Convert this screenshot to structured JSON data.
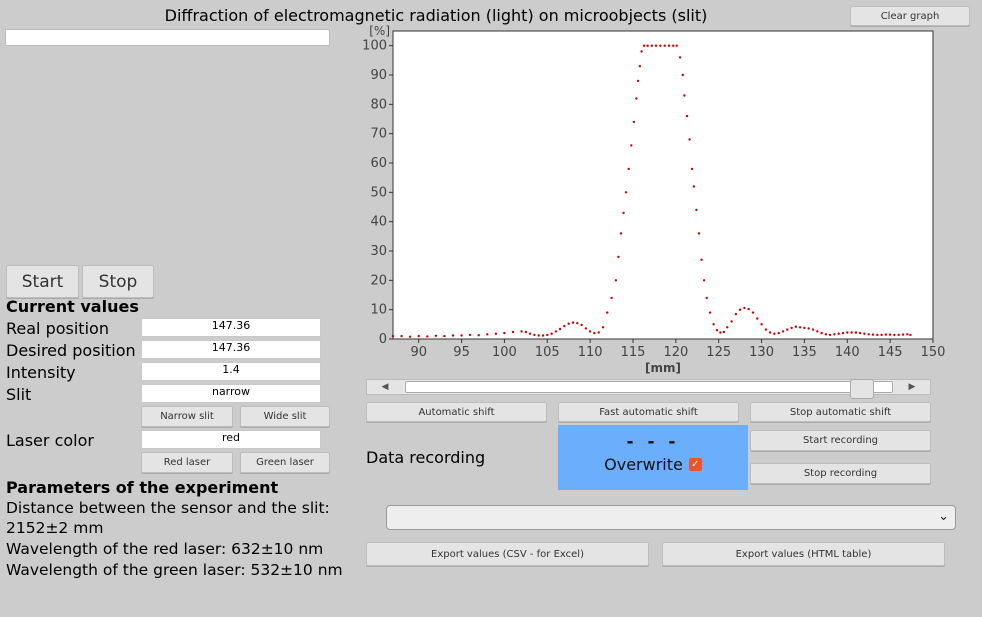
{
  "title": "Diffraction of electromagnetic radiation (light) on microobjects (slit)",
  "buttons": {
    "clear_graph": "Clear graph",
    "start": "Start",
    "stop": "Stop",
    "narrow_slit": "Narrow slit",
    "wide_slit": "Wide slit",
    "red_laser": "Red laser",
    "green_laser": "Green laser",
    "automatic_shift": "Automatic shift",
    "fast_automatic_shift": "Fast automatic shift",
    "stop_automatic_shift": "Stop automatic shift",
    "start_recording": "Start recording",
    "stop_recording": "Stop recording",
    "export_csv": "Export values (CSV - for Excel)",
    "export_html": "Export values (HTML table)"
  },
  "current_values": {
    "heading": "Current values",
    "real_position_label": "Real position",
    "real_position": "147.36",
    "desired_position_label": "Desired position",
    "desired_position": "147.36",
    "intensity_label": "Intensity",
    "intensity": "1.4",
    "slit_label": "Slit",
    "slit": "narrow",
    "laser_color_label": "Laser color",
    "laser_color": "red"
  },
  "parameters": {
    "heading": "Parameters of the experiment",
    "distance": "Distance between the sensor and the slit: 2152±2 mm",
    "red_wavelength": "Wavelength of the red laser: 632±10 nm",
    "green_wavelength": "Wavelength of the green laser: 532±10 nm"
  },
  "recording": {
    "label": "Data recording",
    "status": "- - -",
    "overwrite_label": "Overwrite",
    "overwrite_checked": true
  },
  "scrollbar": {
    "position": 0.96
  },
  "icons": {
    "scroll_left": "triangle-left-icon",
    "scroll_right": "triangle-right-icon",
    "dropdown": "chevron-down-icon",
    "checkbox": "check-icon"
  },
  "colors": {
    "series": "#cc0000",
    "recording_panel": "#6aaefc",
    "checkbox": "#e8572a"
  },
  "chart_data": {
    "type": "scatter",
    "ylabel": "[%]",
    "xlabel": "[mm]",
    "xlim": [
      87,
      150
    ],
    "ylim": [
      0,
      105
    ],
    "xticks": [
      90,
      95,
      100,
      105,
      110,
      115,
      120,
      125,
      130,
      135,
      140,
      145,
      150
    ],
    "yticks": [
      0,
      10,
      20,
      30,
      40,
      50,
      60,
      70,
      80,
      90,
      100
    ],
    "grid": false,
    "series": [
      {
        "color": "#cc0000",
        "points": [
          [
            87,
            1.0
          ],
          [
            88,
            1.0
          ],
          [
            89,
            0.8
          ],
          [
            90,
            1.0
          ],
          [
            91,
            0.9
          ],
          [
            92,
            1.1
          ],
          [
            93,
            1.0
          ],
          [
            94,
            1.2
          ],
          [
            95,
            1.2
          ],
          [
            96,
            1.4
          ],
          [
            97,
            1.3
          ],
          [
            98,
            1.6
          ],
          [
            99,
            1.8
          ],
          [
            100,
            2.0
          ],
          [
            101,
            2.4
          ],
          [
            102,
            2.6
          ],
          [
            102.5,
            2.4
          ],
          [
            103,
            1.8
          ],
          [
            103.5,
            1.4
          ],
          [
            104,
            1.2
          ],
          [
            104.5,
            1.2
          ],
          [
            105,
            1.4
          ],
          [
            105.5,
            1.8
          ],
          [
            106,
            2.6
          ],
          [
            106.5,
            3.4
          ],
          [
            107,
            4.4
          ],
          [
            107.5,
            5.2
          ],
          [
            108,
            5.6
          ],
          [
            108.5,
            5.4
          ],
          [
            109,
            4.8
          ],
          [
            109.5,
            3.6
          ],
          [
            110,
            2.6
          ],
          [
            110.5,
            2.0
          ],
          [
            111,
            2.2
          ],
          [
            111.5,
            4.0
          ],
          [
            112,
            9
          ],
          [
            112.5,
            14
          ],
          [
            113,
            20
          ],
          [
            113.3,
            28
          ],
          [
            113.6,
            36
          ],
          [
            113.9,
            43
          ],
          [
            114.2,
            50
          ],
          [
            114.5,
            58
          ],
          [
            114.8,
            66
          ],
          [
            115.1,
            74
          ],
          [
            115.4,
            82
          ],
          [
            115.6,
            88
          ],
          [
            115.8,
            93
          ],
          [
            116,
            98
          ],
          [
            116.3,
            100
          ],
          [
            116.7,
            100
          ],
          [
            117.2,
            100
          ],
          [
            117.7,
            100
          ],
          [
            118.2,
            100
          ],
          [
            118.7,
            100
          ],
          [
            119.2,
            100
          ],
          [
            119.7,
            100
          ],
          [
            120.1,
            100
          ],
          [
            120.5,
            96
          ],
          [
            120.8,
            90
          ],
          [
            121,
            83
          ],
          [
            121.3,
            76
          ],
          [
            121.6,
            68
          ],
          [
            121.9,
            58
          ],
          [
            122.1,
            52
          ],
          [
            122.4,
            44
          ],
          [
            122.7,
            36
          ],
          [
            123,
            27
          ],
          [
            123.3,
            20
          ],
          [
            123.6,
            14
          ],
          [
            124,
            9
          ],
          [
            124.4,
            5
          ],
          [
            124.8,
            3
          ],
          [
            125.2,
            2.2
          ],
          [
            125.6,
            2.4
          ],
          [
            126,
            4
          ],
          [
            126.5,
            6
          ],
          [
            127,
            8.5
          ],
          [
            127.5,
            10
          ],
          [
            128,
            10.6
          ],
          [
            128.5,
            10.2
          ],
          [
            129,
            9
          ],
          [
            129.5,
            7
          ],
          [
            130,
            5
          ],
          [
            130.5,
            3.2
          ],
          [
            131,
            2.2
          ],
          [
            131.5,
            1.8
          ],
          [
            132,
            2.0
          ],
          [
            132.5,
            2.6
          ],
          [
            133,
            3.2
          ],
          [
            133.5,
            3.8
          ],
          [
            134,
            4.2
          ],
          [
            134.5,
            4.0
          ],
          [
            135,
            3.8
          ],
          [
            135.5,
            3.6
          ],
          [
            136,
            3.2
          ],
          [
            136.5,
            2.6
          ],
          [
            137,
            2.0
          ],
          [
            137.5,
            1.6
          ],
          [
            138,
            1.4
          ],
          [
            138.5,
            1.6
          ],
          [
            139,
            1.8
          ],
          [
            139.5,
            2.0
          ],
          [
            140,
            2.2
          ],
          [
            140.5,
            2.2
          ],
          [
            141,
            2.2
          ],
          [
            141.5,
            2.0
          ],
          [
            142,
            1.8
          ],
          [
            142.5,
            1.6
          ],
          [
            143,
            1.5
          ],
          [
            143.5,
            1.4
          ],
          [
            144,
            1.4
          ],
          [
            144.5,
            1.5
          ],
          [
            145,
            1.5
          ],
          [
            145.5,
            1.4
          ],
          [
            146,
            1.4
          ],
          [
            146.5,
            1.5
          ],
          [
            147,
            1.6
          ],
          [
            147.36,
            1.4
          ]
        ]
      }
    ]
  }
}
